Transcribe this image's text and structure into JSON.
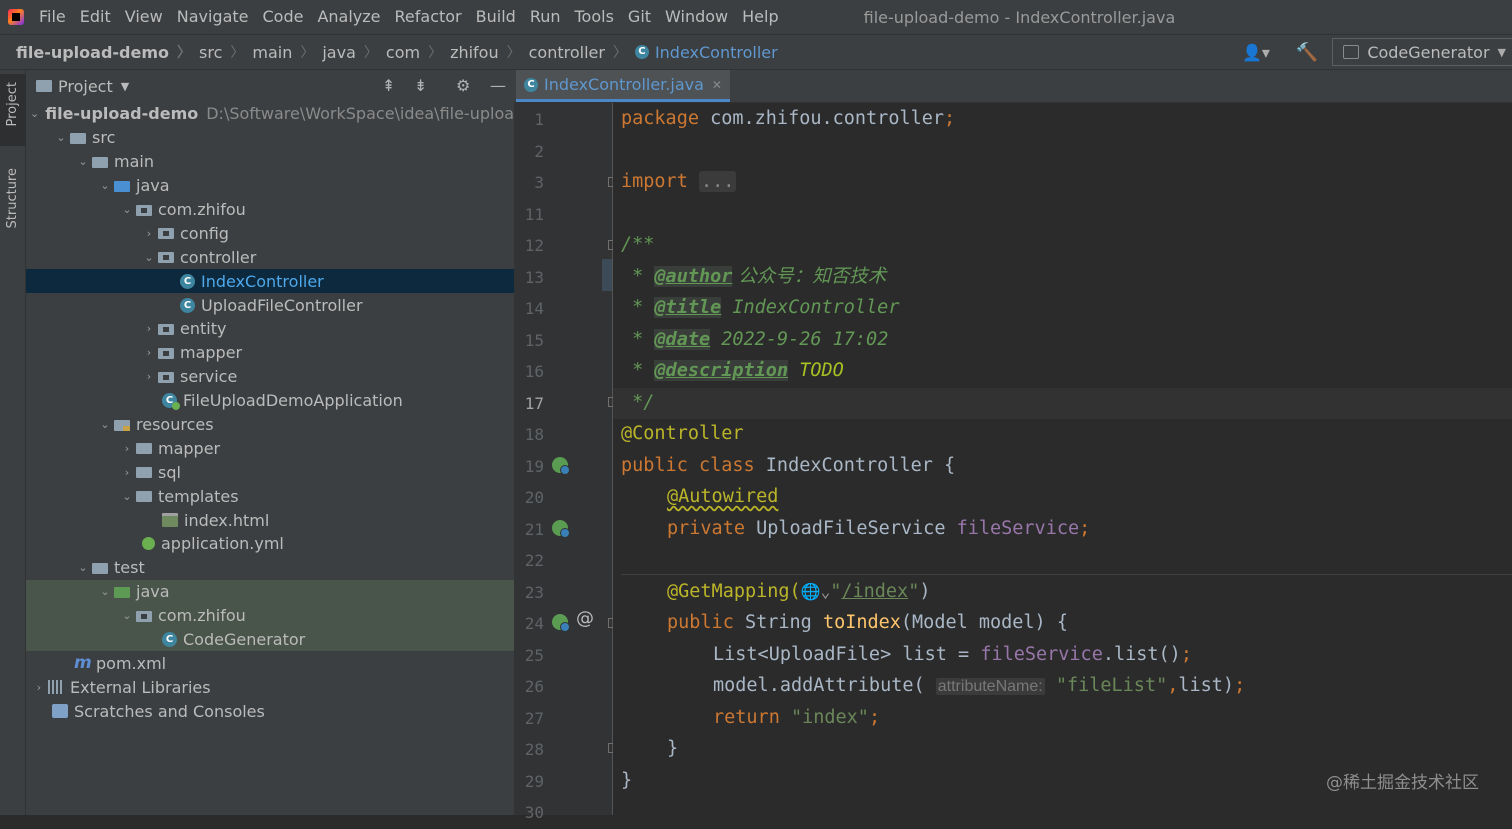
{
  "menubar": {
    "items": [
      "File",
      "Edit",
      "View",
      "Navigate",
      "Code",
      "Analyze",
      "Refactor",
      "Build",
      "Run",
      "Tools",
      "Git",
      "Window",
      "Help"
    ],
    "window_title": "file-upload-demo - IndexController.java"
  },
  "navbar": {
    "breadcrumbs": [
      "file-upload-demo",
      "src",
      "main",
      "java",
      "com",
      "zhifou",
      "controller",
      "IndexController"
    ],
    "run_config": "CodeGenerator"
  },
  "stripe": {
    "project": "Project",
    "structure": "Structure"
  },
  "project_panel": {
    "title": "Project",
    "root_path": "D:\\Software\\WorkSpace\\idea\\file-upload",
    "tree": [
      "file-upload-demo",
      "src",
      "main",
      "java",
      "com.zhifou",
      "config",
      "controller",
      "IndexController",
      "UploadFileController",
      "entity",
      "mapper",
      "service",
      "FileUploadDemoApplication",
      "resources",
      "mapper",
      "sql",
      "templates",
      "index.html",
      "application.yml",
      "test",
      "java",
      "com.zhifou",
      "CodeGenerator",
      "pom.xml",
      "External Libraries",
      "Scratches and Consoles"
    ]
  },
  "editor": {
    "tab": "IndexController.java",
    "line_numbers": [
      "1",
      "2",
      "3",
      "11",
      "12",
      "13",
      "14",
      "15",
      "16",
      "17",
      "18",
      "19",
      "20",
      "21",
      "22",
      "23",
      "24",
      "25",
      "26",
      "27",
      "28",
      "29",
      "30"
    ],
    "code": {
      "l1_kw": "package",
      "l1_rest": " com.zhifou.controller",
      "semi": ";",
      "l3_kw": "import",
      "l3_fold": "...",
      "l12": "/**",
      "l13_star": " * ",
      "l13_tag": "@author",
      "l13_text": " 公众号：知否技术",
      "l14_tag": "@title",
      "l14_text": " IndexController",
      "l15_tag": "@date",
      "l15_text": " 2022-9-26 17:02",
      "l16_tag": "@description",
      "l16_text": " TODO",
      "l17": " */",
      "l18": "@Controller",
      "l19_kw": "public class",
      "l19_rest": " IndexController {",
      "l20": "@Autowired",
      "l21_kw": "private",
      "l21_type": " UploadFileService ",
      "l21_field": "fileService",
      "l23_ann": "@GetMapping(",
      "l23_str_q": "\"",
      "l23_path": "/index",
      "l23_end": ")",
      "l24_kw": "public",
      "l24_type": " String ",
      "l24_fn": "toIndex",
      "l24_params": "(Model model) {",
      "l25_a": "List<UploadFile> list = ",
      "l25_field": "fileService",
      "l25_b": ".list()",
      "l26_a": "model.addAttribute(",
      "l26_hint": "attributeName:",
      "l26_str": "\"fileList\"",
      "l26_comma": ",",
      "l26_b": "list)",
      "l27_kw": "return",
      "l27_str": " \"index\"",
      "l28": "}",
      "l29": "}"
    }
  },
  "watermark": "@稀土掘金技术社区"
}
